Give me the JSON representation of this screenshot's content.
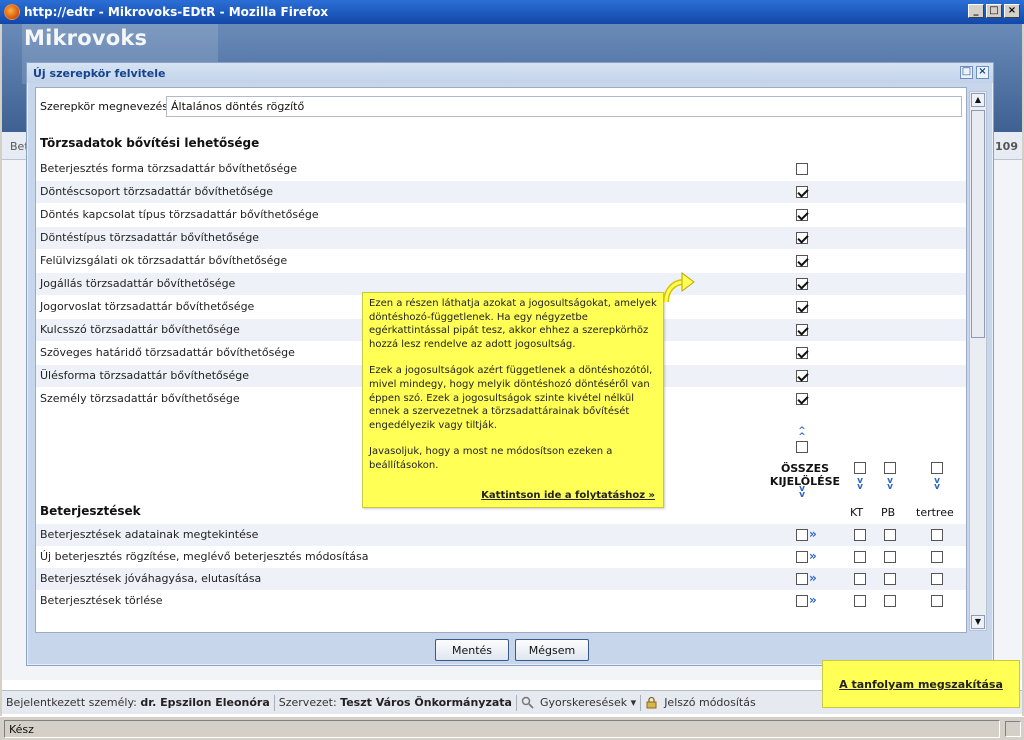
{
  "window": {
    "title": "http://edtr - Mikrovoks-EDtR - Mozilla Firefox",
    "min": "_",
    "max": "□",
    "close": "×"
  },
  "app": {
    "logo": "Mikrovoks",
    "subbar_left": "Bet",
    "subbar_right": "109"
  },
  "dialog": {
    "title": "Új szerepkör felvitele",
    "name_label": "Szerepkör megnevezése:",
    "name_value": "Általános döntés rögzítő",
    "section1": "Törzsadatok bővítési lehetősége",
    "rows1": [
      {
        "label": "Beterjesztés forma törzsadattár bővíthetősége",
        "checked": false
      },
      {
        "label": "Döntéscsoport törzsadattár bővíthetősége",
        "checked": true
      },
      {
        "label": "Döntés kapcsolat típus törzsadattár bővíthetősége",
        "checked": true
      },
      {
        "label": "Döntéstípus törzsadattár bővíthetősége",
        "checked": true
      },
      {
        "label": "Felülvizsgálati ok törzsadattár bővíthetősége",
        "checked": true
      },
      {
        "label": "Jogállás törzsadattár bővíthetősége",
        "checked": true
      },
      {
        "label": "Jogorvoslat törzsadattár bővíthetősége",
        "checked": true
      },
      {
        "label": "Kulcsszó törzsadattár bővíthetősége",
        "checked": true
      },
      {
        "label": "Szöveges határidő törzsadattár bővíthetősége",
        "checked": true
      },
      {
        "label": "Ülésforma törzsadattár bővíthetősége",
        "checked": true
      },
      {
        "label": "Személy törzsadattár bővíthetősége",
        "checked": true
      }
    ],
    "select_all": "ÖSSZES KIJELÖLÉSE",
    "section2": "Beterjesztések",
    "columns": [
      "KT",
      "PB",
      "tertree"
    ],
    "rows2": [
      "Beterjesztések adatainak megtekintése",
      "Új beterjesztés rögzítése, meglévő beterjesztés módosítása",
      "Beterjesztések jóváhagyása, elutasítása",
      "Beterjesztések törlése"
    ],
    "save": "Mentés",
    "cancel": "Mégsem"
  },
  "tooltip": {
    "p1": "Ezen a részen láthatja azokat a jogosultságokat, amelyek döntéshozó-függetlenek. Ha egy négyzetbe egérkattintással pipát tesz, akkor ehhez a szerepkörhöz hozzá lesz rendelve az adott jogosultság.",
    "p2": "Ezek a jogosultságok azért függetlenek a döntéshozótól, mivel mindegy, hogy melyik döntéshozó döntéséről van éppen szó. Ezek a jogosultságok szinte kivétel nélkül ennek a szervezetnek a törzsadattárainak bővítését engedélyezik vagy tiltják.",
    "p3": "Javasoljuk, hogy a most ne módosítson ezeken a beállításokon.",
    "continue": "Kattintson ide a folytatáshoz »"
  },
  "abort": "A tanfolyam megszakítása",
  "status": {
    "user_label": "Bejelentkezett személy:",
    "user": "dr. Epszilon Eleonóra",
    "org_label": "Szervezet:",
    "org": "Teszt Város Önkormányzata",
    "quicksearch": "Gyorskeresések",
    "password": "Jelszó módosítás"
  },
  "ffstatus": "Kész"
}
